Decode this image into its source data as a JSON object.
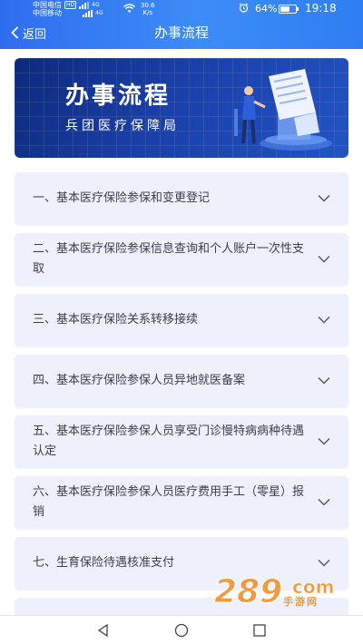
{
  "status_bar": {
    "carrier1": "中国电信",
    "carrier2": "中国移动",
    "hd_badge": "HD",
    "net1": "4G",
    "net2": "4G",
    "speed_value": "30.6",
    "speed_unit": "K/s",
    "battery": "64%",
    "battery_level": 0.64,
    "time": "19:18"
  },
  "header": {
    "back_label": "返回",
    "title": "办事流程"
  },
  "banner": {
    "title": "办事流程",
    "subtitle": "兵团医疗保障局"
  },
  "items": [
    {
      "label": "一、基本医疗保险参保和变更登记"
    },
    {
      "label": "二、基本医疗保险参保信息查询和个人账户一次性支取"
    },
    {
      "label": "三、基本医疗保险关系转移接续"
    },
    {
      "label": "四、基本医疗保险参保人员异地就医备案"
    },
    {
      "label": "五、基本医疗保险参保人员享受门诊慢特病病种待遇认定"
    },
    {
      "label": "六、基本医疗保险参保人员医疗费用手工（零星）报销"
    },
    {
      "label": "七、生育保险待遇核准支付"
    }
  ],
  "watermark": {
    "text": "289",
    "suffix": "com",
    "sub": "手游网"
  },
  "colors": {
    "header": "#2f6df0",
    "item_bg": "#eef1fc",
    "banner_dark": "#0c2a7a",
    "watermark": "#f19a3e"
  },
  "icons": [
    "back-chevron-icon",
    "chevron-down-icon",
    "wifi-icon",
    "alarm-icon",
    "battery-icon",
    "nav-back-icon",
    "nav-home-icon",
    "nav-recents-icon"
  ]
}
